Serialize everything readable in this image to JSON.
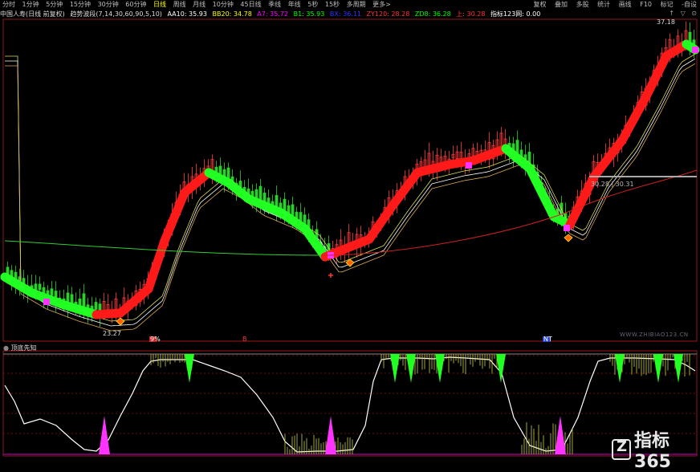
{
  "toolbar": {
    "periods": [
      "分时",
      "1分钟",
      "5分钟",
      "15分钟",
      "30分钟",
      "60分钟",
      "日线",
      "周线",
      "月线",
      "10分钟",
      "45日线",
      "季线",
      "年线",
      "5秒",
      "15秒",
      "多周期",
      "更多>"
    ],
    "active_period": "日线",
    "right_buttons": [
      "复权",
      "叠加",
      "多股",
      "统计",
      "画线",
      "F10",
      "标记",
      "-自设"
    ]
  },
  "legend": {
    "stock": "中国人寿(日线 前复权)",
    "indicator": "趋势波段(7,14,30,60,90,5,10)",
    "aa": "AA10: 35.93",
    "bb": "BB20: 34.78",
    "a7": "A7: 35.72",
    "b1": "B1: 35.93",
    "bx": "BX: 36.11",
    "zy": "ZY120: 28.28",
    "zd": "ZD8: 36.28",
    "top": "上: 30.28",
    "idx": "指标123网: 0.00",
    "colors": {
      "aa": "#ffffff",
      "bb": "#ffff00",
      "a7": "#ff00ff",
      "b1": "#00ff00",
      "bx": "#3333ff",
      "zy": "#ff3333",
      "zd": "#00ff00",
      "top": "#ff3333",
      "idx": "#ffffff"
    }
  },
  "window_controls": [
    "↑",
    "▽",
    "⊙"
  ],
  "price_labels": {
    "high": "37.18",
    "low": "23.27",
    "crosshair": "30.28 | 30.31"
  },
  "marker_labels": {
    "b1": "9%",
    "b2": "B",
    "b3": "NT"
  },
  "lower_panel": {
    "title": "顶底先知"
  },
  "watermark": "WWW.ZHIBIAO123.CN",
  "brand": "指标365"
}
